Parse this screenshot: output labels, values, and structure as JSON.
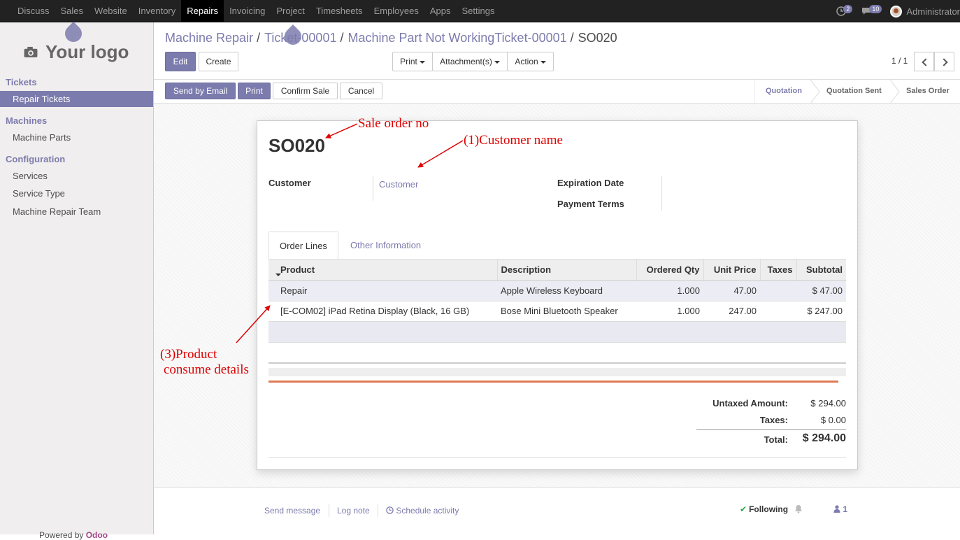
{
  "topnav": {
    "menu": [
      "Discuss",
      "Sales",
      "Website",
      "Inventory",
      "Repairs",
      "Invoicing",
      "Project",
      "Timesheets",
      "Employees",
      "Apps",
      "Settings"
    ],
    "active_index": 4,
    "chat_count": "2",
    "message_count": "10",
    "user_name": "Administrator"
  },
  "sidebar": {
    "logo_text": "Your logo",
    "sections": [
      {
        "heading": "Tickets",
        "items": [
          "Repair Tickets"
        ]
      },
      {
        "heading": "Machines",
        "items": [
          "Machine Parts"
        ]
      },
      {
        "heading": "Configuration",
        "items": [
          "Services",
          "Service Type",
          "Machine Repair Team"
        ]
      }
    ],
    "active_item": "Repair Tickets",
    "powered_by": "Powered by",
    "powered_brand": "Odoo"
  },
  "breadcrumb": {
    "items": [
      "Machine Repair",
      "Ticket-00001",
      "Machine Part Not WorkingTicket-00001"
    ],
    "current": "SO020"
  },
  "toolbar": {
    "edit": "Edit",
    "create": "Create",
    "print": "Print",
    "attachments": "Attachment(s)",
    "action": "Action",
    "pager": "1 / 1"
  },
  "statusbar": {
    "buttons": [
      "Send by Email",
      "Print",
      "Confirm Sale",
      "Cancel"
    ],
    "stages": [
      "Quotation",
      "Quotation Sent",
      "Sales Order"
    ],
    "current_stage": "Quotation"
  },
  "form": {
    "name": "SO020",
    "customer_label": "Customer",
    "customer_value": "Customer",
    "expiration_label": "Expiration Date",
    "payment_terms_label": "Payment Terms",
    "tabs": [
      "Order Lines",
      "Other Information"
    ],
    "columns": [
      "Product",
      "Description",
      "Ordered Qty",
      "Unit Price",
      "Taxes",
      "Subtotal"
    ],
    "lines": [
      {
        "product": "Repair",
        "description": "Apple Wireless Keyboard",
        "qty": "1.000",
        "price": "47.00",
        "taxes": "",
        "subtotal": "$ 47.00"
      },
      {
        "product": "[E-COM02] iPad Retina Display (Black, 16 GB)",
        "description": "Bose Mini Bluetooth Speaker",
        "qty": "1.000",
        "price": "247.00",
        "taxes": "",
        "subtotal": "$ 247.00"
      }
    ],
    "totals": {
      "untaxed_label": "Untaxed Amount:",
      "untaxed_value": "$ 294.00",
      "taxes_label": "Taxes:",
      "taxes_value": "$ 0.00",
      "total_label": "Total:",
      "total_value": "$ 294.00"
    }
  },
  "chatter": {
    "send_message": "Send message",
    "log_note": "Log note",
    "schedule_activity": "Schedule activity",
    "following": "Following",
    "followers_count": "1"
  },
  "annotations": {
    "sale_order": "Sale order no",
    "customer": "(1)Customer name",
    "product_line1": "(3)Product",
    "product_line2": "consume details",
    "color": "#e00000"
  },
  "colors": {
    "brand": "#7c7bad",
    "topbar": "#222222",
    "annotation": "#e00000"
  }
}
